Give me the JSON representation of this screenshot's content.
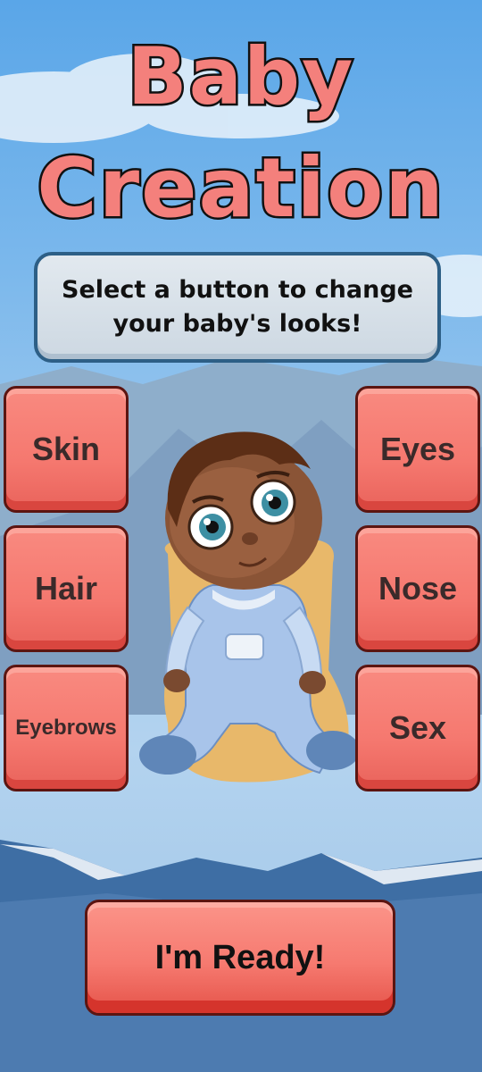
{
  "title": {
    "line1": "Baby",
    "line2": "Creation"
  },
  "instruction": "Select a button to change your baby's looks!",
  "buttons": {
    "skin": "Skin",
    "hair": "Hair",
    "eyebrows": "Eyebrows",
    "eyes": "Eyes",
    "nose": "Nose",
    "sex": "Sex"
  },
  "ready_label": "I'm Ready!",
  "colors": {
    "button": "#f5786f",
    "title": "#f4807c",
    "panel": "#d6dfe7",
    "outline": "#111111"
  }
}
